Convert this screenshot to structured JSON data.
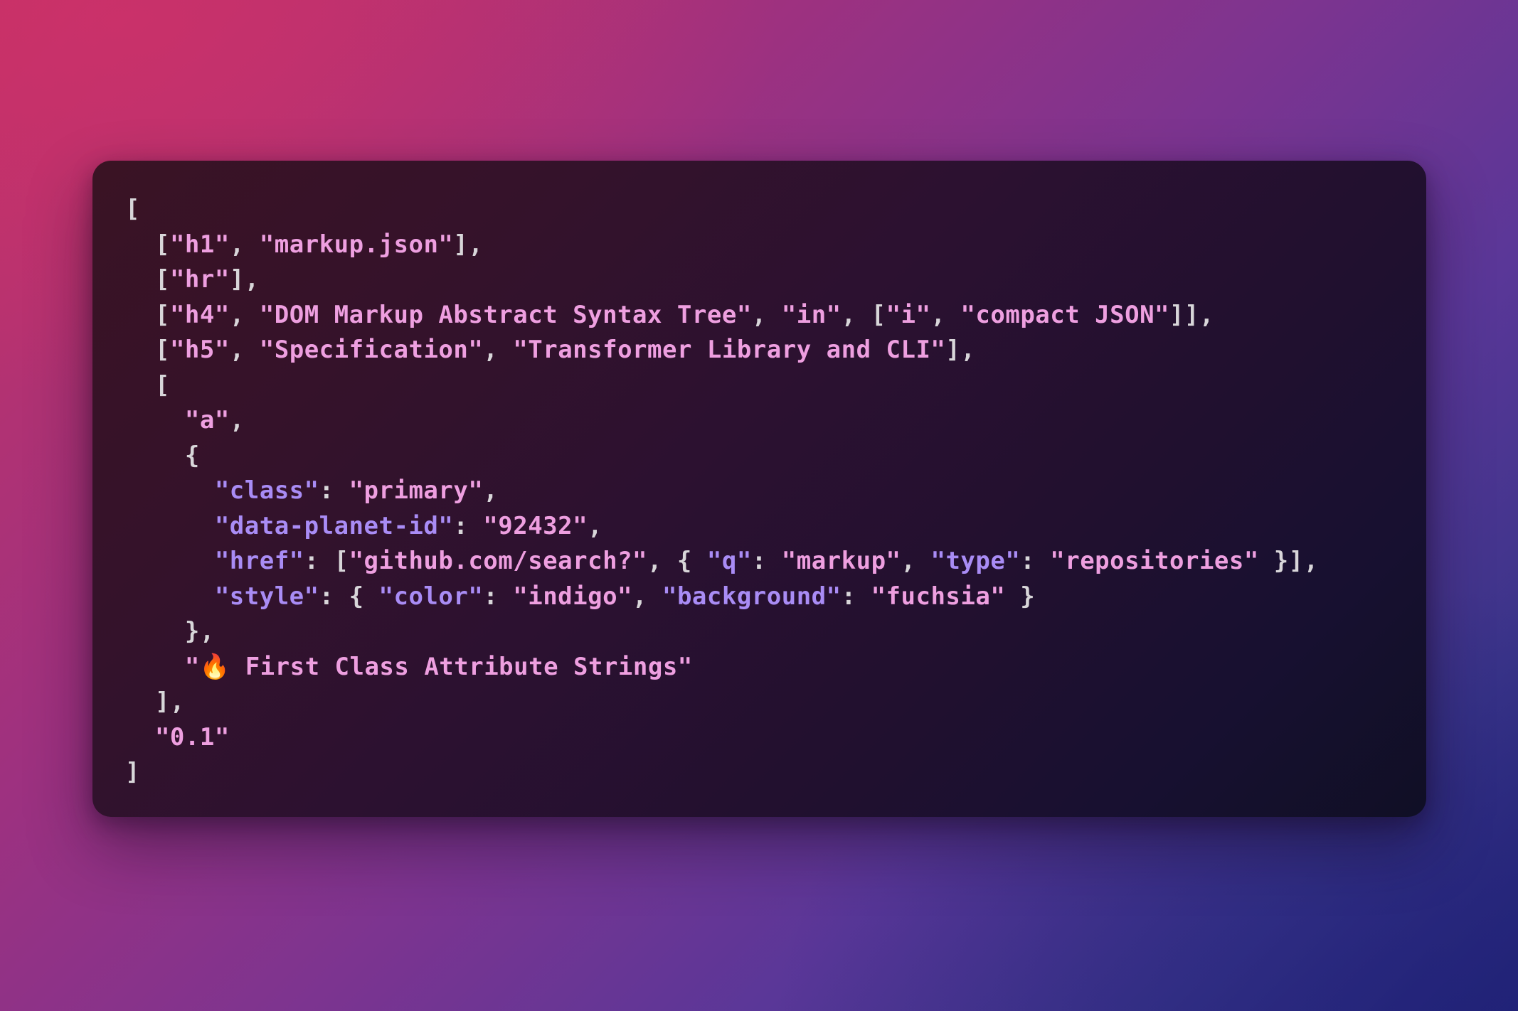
{
  "window": {
    "title": "markup.json code snippet",
    "background": {
      "gradient_from": "#bf3268",
      "gradient_mid": "#7c3490",
      "gradient_to": "#242576"
    },
    "card": {
      "background_from": "#3a1324",
      "background_to": "#100f25",
      "corner_radius": "26px"
    }
  },
  "theme": {
    "punctuation_color": "#d8d6d9",
    "string_color": "#ee9fe0",
    "key_color": "#a98cf5",
    "font": "monospace"
  },
  "code": {
    "language": "json",
    "indent_unit": "  ",
    "lines": [
      {
        "indent": 0,
        "tokens": [
          {
            "t": "pun",
            "v": "["
          }
        ]
      },
      {
        "indent": 1,
        "tokens": [
          {
            "t": "pun",
            "v": "["
          },
          {
            "t": "str",
            "v": "\"h1\""
          },
          {
            "t": "pun",
            "v": ", "
          },
          {
            "t": "str",
            "v": "\"markup.json\""
          },
          {
            "t": "pun",
            "v": "],"
          }
        ]
      },
      {
        "indent": 1,
        "tokens": [
          {
            "t": "pun",
            "v": "["
          },
          {
            "t": "str",
            "v": "\"hr\""
          },
          {
            "t": "pun",
            "v": "],"
          }
        ]
      },
      {
        "indent": 1,
        "tokens": [
          {
            "t": "pun",
            "v": "["
          },
          {
            "t": "str",
            "v": "\"h4\""
          },
          {
            "t": "pun",
            "v": ", "
          },
          {
            "t": "str",
            "v": "\"DOM Markup Abstract Syntax Tree\""
          },
          {
            "t": "pun",
            "v": ", "
          },
          {
            "t": "str",
            "v": "\"in\""
          },
          {
            "t": "pun",
            "v": ", ["
          },
          {
            "t": "str",
            "v": "\"i\""
          },
          {
            "t": "pun",
            "v": ", "
          },
          {
            "t": "str",
            "v": "\"compact JSON\""
          },
          {
            "t": "pun",
            "v": "]],"
          }
        ]
      },
      {
        "indent": 1,
        "tokens": [
          {
            "t": "pun",
            "v": "["
          },
          {
            "t": "str",
            "v": "\"h5\""
          },
          {
            "t": "pun",
            "v": ", "
          },
          {
            "t": "str",
            "v": "\"Specification\""
          },
          {
            "t": "pun",
            "v": ", "
          },
          {
            "t": "str",
            "v": "\"Transformer Library and CLI\""
          },
          {
            "t": "pun",
            "v": "],"
          }
        ]
      },
      {
        "indent": 1,
        "tokens": [
          {
            "t": "pun",
            "v": "["
          }
        ]
      },
      {
        "indent": 2,
        "tokens": [
          {
            "t": "str",
            "v": "\"a\""
          },
          {
            "t": "pun",
            "v": ","
          }
        ]
      },
      {
        "indent": 2,
        "tokens": [
          {
            "t": "pun",
            "v": "{"
          }
        ]
      },
      {
        "indent": 3,
        "tokens": [
          {
            "t": "key",
            "v": "\"class\""
          },
          {
            "t": "pun",
            "v": ": "
          },
          {
            "t": "str",
            "v": "\"primary\""
          },
          {
            "t": "pun",
            "v": ","
          }
        ]
      },
      {
        "indent": 3,
        "tokens": [
          {
            "t": "key",
            "v": "\"data-planet-id\""
          },
          {
            "t": "pun",
            "v": ": "
          },
          {
            "t": "str",
            "v": "\"92432\""
          },
          {
            "t": "pun",
            "v": ","
          }
        ]
      },
      {
        "indent": 3,
        "tokens": [
          {
            "t": "key",
            "v": "\"href\""
          },
          {
            "t": "pun",
            "v": ": ["
          },
          {
            "t": "str",
            "v": "\"github.com/search?\""
          },
          {
            "t": "pun",
            "v": ", { "
          },
          {
            "t": "key",
            "v": "\"q\""
          },
          {
            "t": "pun",
            "v": ": "
          },
          {
            "t": "str",
            "v": "\"markup\""
          },
          {
            "t": "pun",
            "v": ", "
          },
          {
            "t": "key",
            "v": "\"type\""
          },
          {
            "t": "pun",
            "v": ": "
          },
          {
            "t": "str",
            "v": "\"repositories\""
          },
          {
            "t": "pun",
            "v": " }],"
          }
        ]
      },
      {
        "indent": 3,
        "tokens": [
          {
            "t": "key",
            "v": "\"style\""
          },
          {
            "t": "pun",
            "v": ": { "
          },
          {
            "t": "key",
            "v": "\"color\""
          },
          {
            "t": "pun",
            "v": ": "
          },
          {
            "t": "str",
            "v": "\"indigo\""
          },
          {
            "t": "pun",
            "v": ", "
          },
          {
            "t": "key",
            "v": "\"background\""
          },
          {
            "t": "pun",
            "v": ": "
          },
          {
            "t": "str",
            "v": "\"fuchsia\""
          },
          {
            "t": "pun",
            "v": " }"
          }
        ]
      },
      {
        "indent": 2,
        "tokens": [
          {
            "t": "pun",
            "v": "},"
          }
        ]
      },
      {
        "indent": 2,
        "tokens": [
          {
            "t": "str",
            "v": "\""
          },
          {
            "t": "emoji",
            "v": "🔥"
          },
          {
            "t": "str",
            "v": " First Class Attribute Strings\""
          }
        ]
      },
      {
        "indent": 1,
        "tokens": [
          {
            "t": "pun",
            "v": "],"
          }
        ]
      },
      {
        "indent": 1,
        "tokens": [
          {
            "t": "str",
            "v": "\"0.1\""
          }
        ]
      },
      {
        "indent": 0,
        "tokens": [
          {
            "t": "pun",
            "v": "]"
          }
        ]
      }
    ]
  }
}
